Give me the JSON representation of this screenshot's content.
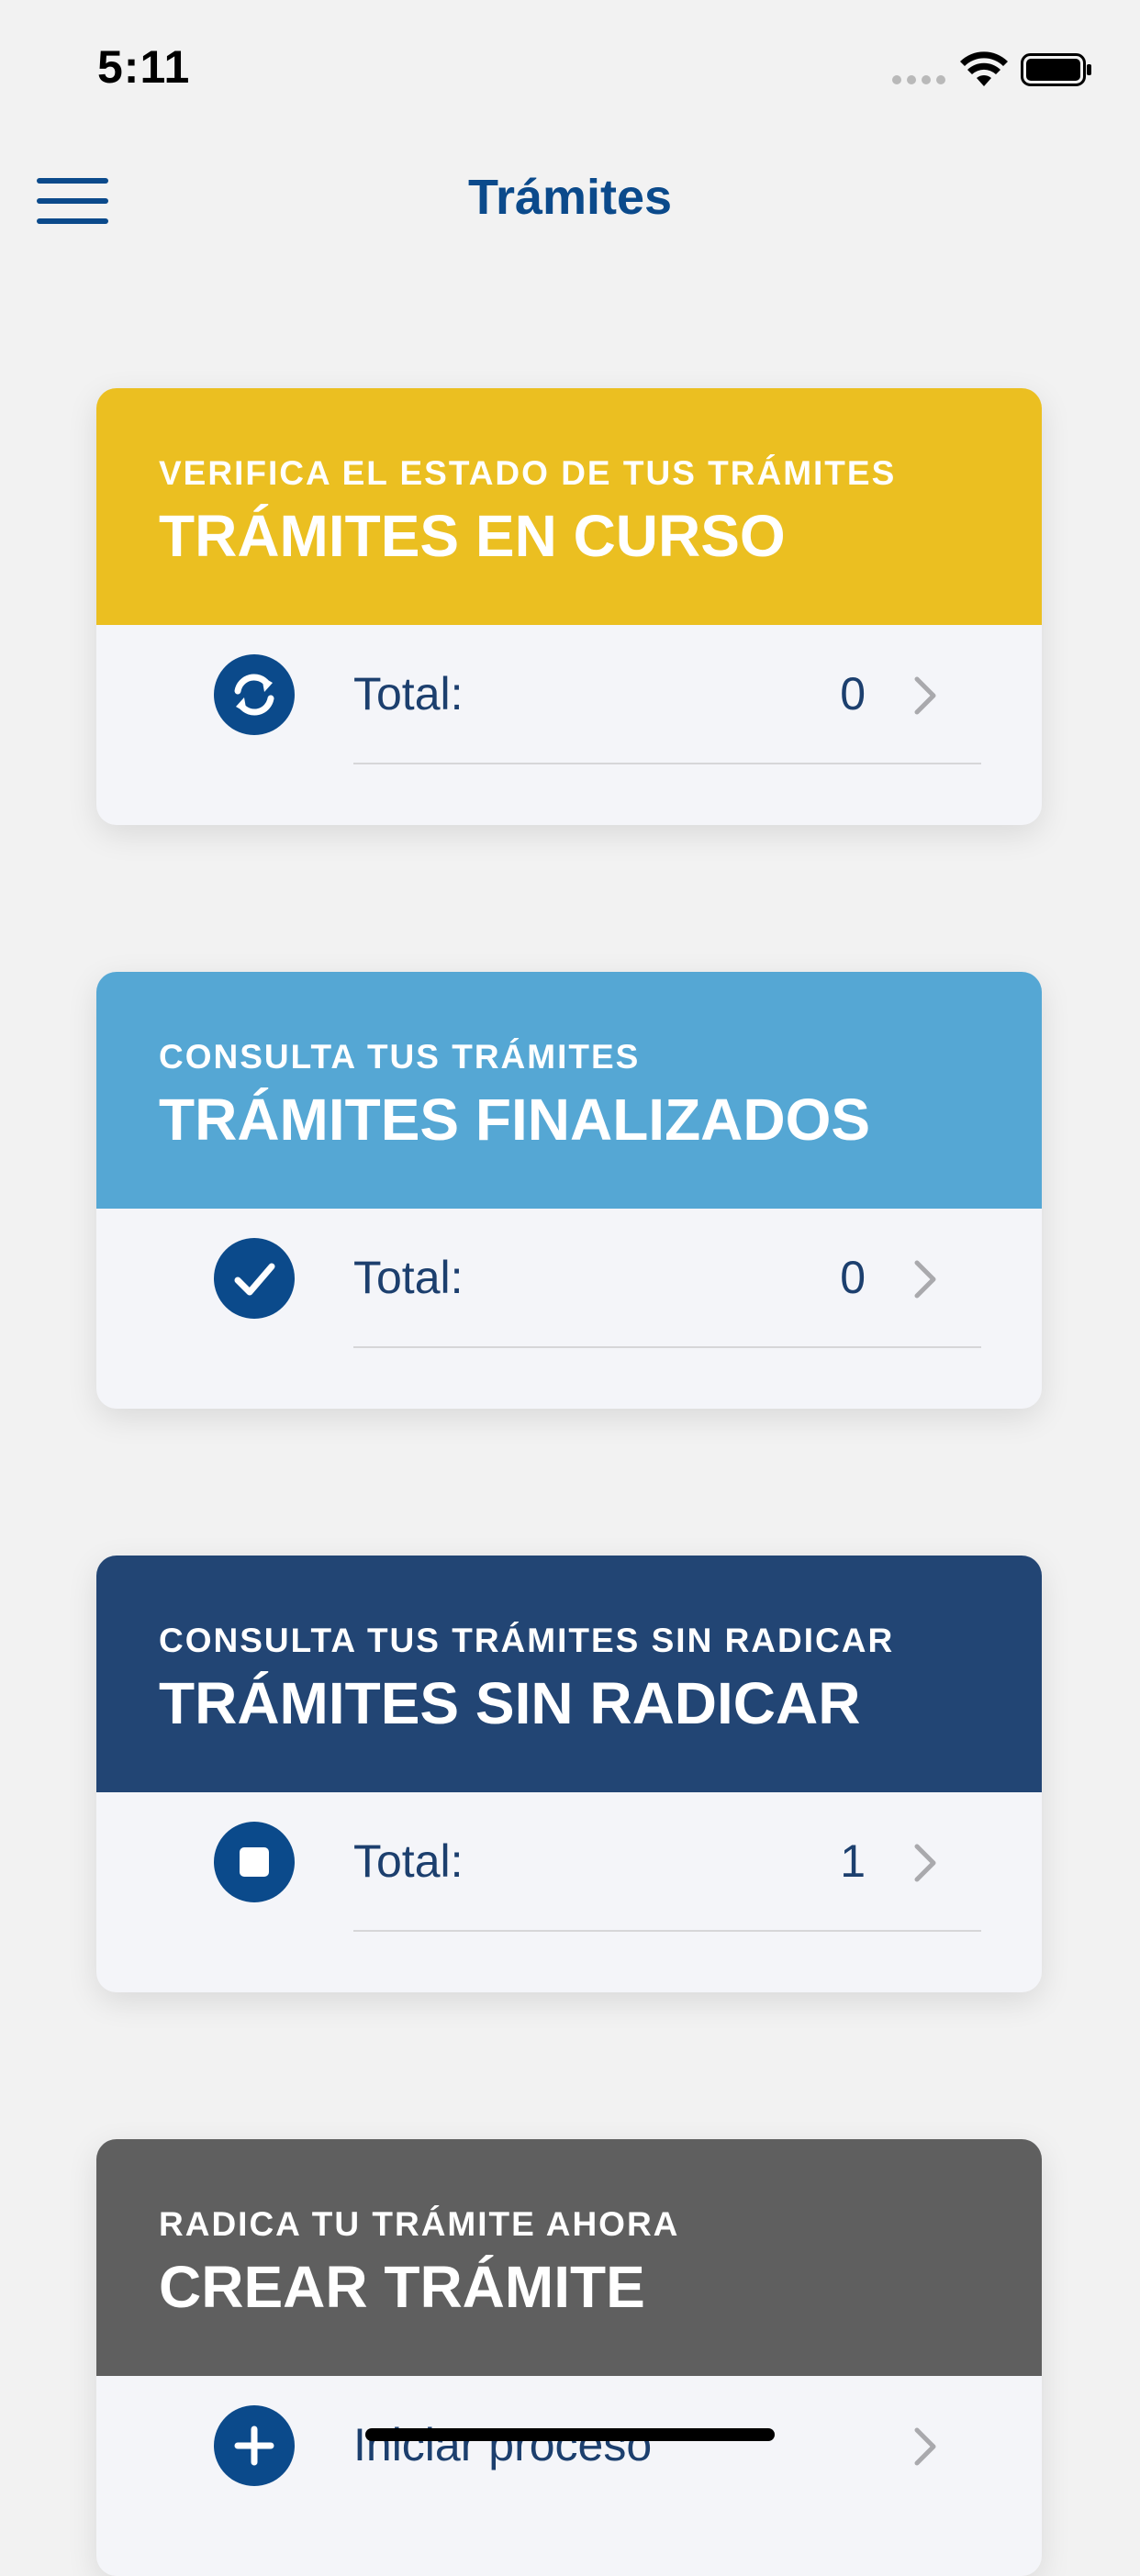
{
  "status_bar": {
    "time": "5:11"
  },
  "nav": {
    "title": "Trámites"
  },
  "cards": [
    {
      "subtitle": "VERIFICA EL ESTADO DE TUS TRÁMITES",
      "title": "TRÁMITES EN CURSO",
      "row_label": "Total:",
      "count": "0",
      "color": "#ebbf21",
      "icon": "sync-icon"
    },
    {
      "subtitle": "CONSULTA TUS TRÁMITES",
      "title": "TRÁMITES FINALIZADOS",
      "row_label": "Total:",
      "count": "0",
      "color": "#55a7d4",
      "icon": "check-icon"
    },
    {
      "subtitle": "CONSULTA TUS TRÁMITES SIN RADICAR",
      "title": "TRÁMITES SIN RADICAR",
      "row_label": "Total:",
      "count": "1",
      "color": "#224574",
      "icon": "stop-icon"
    },
    {
      "subtitle": "RADICA TU TRÁMITE AHORA",
      "title": "CREAR TRÁMITE",
      "row_label": "Iniciar proceso",
      "count": "",
      "color": "#5f5f5f",
      "icon": "plus-icon"
    }
  ]
}
